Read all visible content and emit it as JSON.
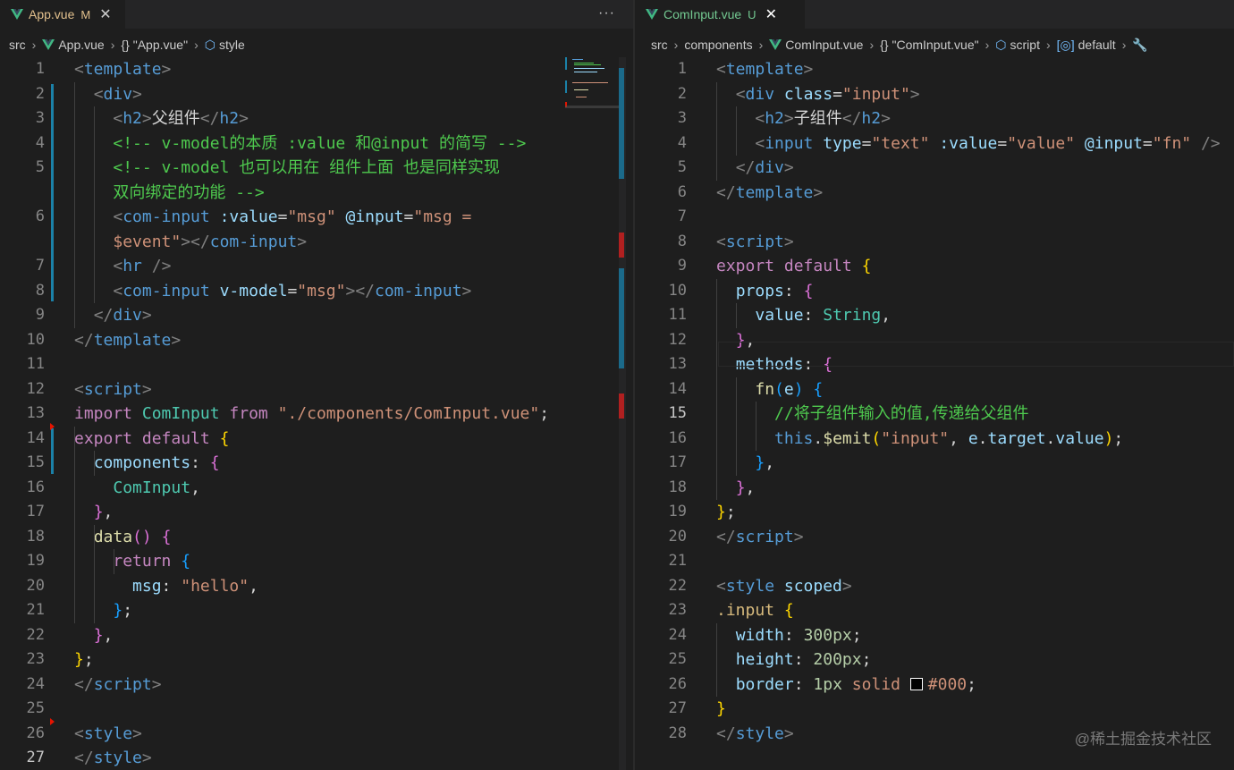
{
  "left": {
    "tab": {
      "name": "App.vue",
      "status": "M"
    },
    "more": "···",
    "breadcrumb": [
      "src",
      "App.vue",
      "\"App.vue\"",
      "style"
    ],
    "lines": [
      {
        "n": "1",
        "html": "<span class=\"t-tag\">&lt;</span><span class=\"t-tn\">template</span><span class=\"t-tag\">&gt;</span>"
      },
      {
        "n": "2",
        "html": "  <span class=\"t-tag\">&lt;</span><span class=\"t-tn\">div</span><span class=\"t-tag\">&gt;</span>"
      },
      {
        "n": "3",
        "html": "    <span class=\"t-tag\">&lt;</span><span class=\"t-tn\">h2</span><span class=\"t-tag\">&gt;</span><span class=\"t-txt\">父组件</span><span class=\"t-tag\">&lt;/</span><span class=\"t-tn\">h2</span><span class=\"t-tag\">&gt;</span>"
      },
      {
        "n": "4",
        "html": "    <span class=\"t-green\">&lt;!-- v-model的本质 :value 和@input 的简写 --&gt;</span>"
      },
      {
        "n": "5",
        "html": "    <span class=\"t-green\">&lt;!-- v-model 也可以用在 组件上面 也是同样实现</span>"
      },
      {
        "n": "",
        "html": "    <span class=\"t-green\">双向绑定的功能 --&gt;</span>"
      },
      {
        "n": "6",
        "html": "    <span class=\"t-tag\">&lt;</span><span class=\"t-tn\">com-input</span> <span class=\"t-attr\">:value</span><span class=\"t-punc\">=</span><span class=\"t-str\">\"msg\"</span> <span class=\"t-attr\">@input</span><span class=\"t-punc\">=</span><span class=\"t-str\">\"msg =</span>"
      },
      {
        "n": "",
        "html": "    <span class=\"t-str\">$event\"</span><span class=\"t-tag\">&gt;&lt;/</span><span class=\"t-tn\">com-input</span><span class=\"t-tag\">&gt;</span>"
      },
      {
        "n": "7",
        "html": "    <span class=\"t-tag\">&lt;</span><span class=\"t-tn\">hr</span> <span class=\"t-tag\">/&gt;</span>"
      },
      {
        "n": "8",
        "html": "    <span class=\"t-tag\">&lt;</span><span class=\"t-tn\">com-input</span> <span class=\"t-attr\">v-model</span><span class=\"t-punc\">=</span><span class=\"t-str\">\"msg\"</span><span class=\"t-tag\">&gt;&lt;/</span><span class=\"t-tn\">com-input</span><span class=\"t-tag\">&gt;</span>"
      },
      {
        "n": "9",
        "html": "  <span class=\"t-tag\">&lt;/</span><span class=\"t-tn\">div</span><span class=\"t-tag\">&gt;</span>"
      },
      {
        "n": "10",
        "html": "<span class=\"t-tag\">&lt;/</span><span class=\"t-tn\">template</span><span class=\"t-tag\">&gt;</span>"
      },
      {
        "n": "11",
        "html": ""
      },
      {
        "n": "12",
        "html": "<span class=\"t-tag\">&lt;</span><span class=\"t-tn\">script</span><span class=\"t-tag\">&gt;</span>"
      },
      {
        "n": "13",
        "html": "<span class=\"t-kw\">import</span> <span class=\"t-type\">ComInput</span> <span class=\"t-kw\">from</span> <span class=\"t-str\">\"./components/ComInput.vue\"</span><span class=\"t-punc\">;</span>"
      },
      {
        "n": "14",
        "html": "<span class=\"t-kw\">export</span> <span class=\"t-kw\">default</span> <span class=\"t-b1\">{</span>"
      },
      {
        "n": "15",
        "html": "  <span class=\"t-prop\">components</span><span class=\"t-punc\">:</span> <span class=\"t-b2\">{</span>"
      },
      {
        "n": "16",
        "html": "    <span class=\"t-type\">ComInput</span><span class=\"t-punc\">,</span>"
      },
      {
        "n": "17",
        "html": "  <span class=\"t-b2\">}</span><span class=\"t-punc\">,</span>"
      },
      {
        "n": "18",
        "html": "  <span class=\"t-fn\">data</span><span class=\"t-b2\">()</span> <span class=\"t-b2\">{</span>"
      },
      {
        "n": "19",
        "html": "    <span class=\"t-kw\">return</span> <span class=\"t-b3\">{</span>"
      },
      {
        "n": "20",
        "html": "      <span class=\"t-prop\">msg</span><span class=\"t-punc\">:</span> <span class=\"t-str\">\"hello\"</span><span class=\"t-punc\">,</span>"
      },
      {
        "n": "21",
        "html": "    <span class=\"t-b3\">}</span><span class=\"t-punc\">;</span>"
      },
      {
        "n": "22",
        "html": "  <span class=\"t-b2\">}</span><span class=\"t-punc\">,</span>"
      },
      {
        "n": "23",
        "html": "<span class=\"t-b1\">}</span><span class=\"t-punc\">;</span>"
      },
      {
        "n": "24",
        "html": "<span class=\"t-tag\">&lt;/</span><span class=\"t-tn\">script</span><span class=\"t-tag\">&gt;</span>"
      },
      {
        "n": "25",
        "html": ""
      },
      {
        "n": "26",
        "html": "<span class=\"t-tag\">&lt;</span><span class=\"t-tn\">style</span><span class=\"t-tag\">&gt;</span>"
      },
      {
        "n": "27",
        "html": "<span class=\"t-tag\">&lt;/</span><span class=\"t-tn\">style</span><span class=\"t-tag\">&gt;</span>"
      }
    ]
  },
  "right": {
    "tab": {
      "name": "ComInput.vue",
      "status": "U"
    },
    "breadcrumb": [
      "src",
      "components",
      "ComInput.vue",
      "\"ComInput.vue\"",
      "script",
      "default"
    ],
    "lines": [
      {
        "n": "1",
        "html": "<span class=\"t-tag\">&lt;</span><span class=\"t-tn\">template</span><span class=\"t-tag\">&gt;</span>"
      },
      {
        "n": "2",
        "html": "  <span class=\"t-tag\">&lt;</span><span class=\"t-tn\">div</span> <span class=\"t-attr\">class</span><span class=\"t-punc\">=</span><span class=\"t-str\">\"input\"</span><span class=\"t-tag\">&gt;</span>"
      },
      {
        "n": "3",
        "html": "    <span class=\"t-tag\">&lt;</span><span class=\"t-tn\">h2</span><span class=\"t-tag\">&gt;</span><span class=\"t-txt\">子组件</span><span class=\"t-tag\">&lt;/</span><span class=\"t-tn\">h2</span><span class=\"t-tag\">&gt;</span>"
      },
      {
        "n": "4",
        "html": "    <span class=\"t-tag\">&lt;</span><span class=\"t-tn\">input</span> <span class=\"t-attr\">type</span><span class=\"t-punc\">=</span><span class=\"t-str\">\"text\"</span> <span class=\"t-attr\">:value</span><span class=\"t-punc\">=</span><span class=\"t-str\">\"value\"</span> <span class=\"t-attr\">@input</span><span class=\"t-punc\">=</span><span class=\"t-str\">\"fn\"</span> <span class=\"t-tag\">/&gt;</span>"
      },
      {
        "n": "5",
        "html": "  <span class=\"t-tag\">&lt;/</span><span class=\"t-tn\">div</span><span class=\"t-tag\">&gt;</span>"
      },
      {
        "n": "6",
        "html": "<span class=\"t-tag\">&lt;/</span><span class=\"t-tn\">template</span><span class=\"t-tag\">&gt;</span>"
      },
      {
        "n": "7",
        "html": ""
      },
      {
        "n": "8",
        "html": "<span class=\"t-tag\">&lt;</span><span class=\"t-tn\">script</span><span class=\"t-tag\">&gt;</span>"
      },
      {
        "n": "9",
        "html": "<span class=\"t-kw\">export</span> <span class=\"t-kw\">default</span> <span class=\"t-b1\">{</span>"
      },
      {
        "n": "10",
        "html": "  <span class=\"t-prop\">props</span><span class=\"t-punc\">:</span> <span class=\"t-b2\">{</span>"
      },
      {
        "n": "11",
        "html": "    <span class=\"t-prop\">value</span><span class=\"t-punc\">:</span> <span class=\"t-type\">String</span><span class=\"t-punc\">,</span>"
      },
      {
        "n": "12",
        "html": "  <span class=\"t-b2\">}</span><span class=\"t-punc\">,</span>"
      },
      {
        "n": "13",
        "html": "  <span class=\"t-prop\">methods</span><span class=\"t-punc\">:</span> <span class=\"t-b2\">{</span>"
      },
      {
        "n": "14",
        "html": "    <span class=\"t-fn\">fn</span><span class=\"t-b3\">(</span><span class=\"t-prop\">e</span><span class=\"t-b3\">)</span> <span class=\"t-b3\">{</span>"
      },
      {
        "n": "15",
        "html": "      <span class=\"t-green\">//将子组件输入的值,传递给父组件</span>"
      },
      {
        "n": "16",
        "html": "      <span class=\"t-blue\">this</span><span class=\"t-punc\">.</span><span class=\"t-fn\">$emit</span><span class=\"t-b1\">(</span><span class=\"t-str\">\"input\"</span><span class=\"t-punc\">,</span> <span class=\"t-prop\">e</span><span class=\"t-punc\">.</span><span class=\"t-prop\">target</span><span class=\"t-punc\">.</span><span class=\"t-prop\">value</span><span class=\"t-b1\">)</span><span class=\"t-punc\">;</span>"
      },
      {
        "n": "17",
        "html": "    <span class=\"t-b3\">}</span><span class=\"t-punc\">,</span>"
      },
      {
        "n": "18",
        "html": "  <span class=\"t-b2\">}</span><span class=\"t-punc\">,</span>"
      },
      {
        "n": "19",
        "html": "<span class=\"t-b1\">}</span><span class=\"t-punc\">;</span>"
      },
      {
        "n": "20",
        "html": "<span class=\"t-tag\">&lt;/</span><span class=\"t-tn\">script</span><span class=\"t-tag\">&gt;</span>"
      },
      {
        "n": "21",
        "html": ""
      },
      {
        "n": "22",
        "html": "<span class=\"t-tag\">&lt;</span><span class=\"t-tn\">style</span> <span class=\"t-attr\">scoped</span><span class=\"t-tag\">&gt;</span>"
      },
      {
        "n": "23",
        "html": "<span class=\"t-sel\">.input</span> <span class=\"t-b1\">{</span>"
      },
      {
        "n": "24",
        "html": "  <span class=\"t-prop\">width</span><span class=\"t-punc\">:</span> <span class=\"t-num\">300px</span><span class=\"t-punc\">;</span>"
      },
      {
        "n": "25",
        "html": "  <span class=\"t-prop\">height</span><span class=\"t-punc\">:</span> <span class=\"t-num\">200px</span><span class=\"t-punc\">;</span>"
      },
      {
        "n": "26",
        "html": "  <span class=\"t-prop\">border</span><span class=\"t-punc\">:</span> <span class=\"t-num\">1px</span> <span class=\"t-str\">solid</span> <span class=\"swatch\"></span><span class=\"t-str\">#000</span><span class=\"t-punc\">;</span>"
      },
      {
        "n": "27",
        "html": "<span class=\"t-b1\">}</span>"
      },
      {
        "n": "28",
        "html": "<span class=\"t-tag\">&lt;/</span><span class=\"t-tn\">style</span><span class=\"t-tag\">&gt;</span>"
      }
    ]
  },
  "watermark": "@稀土掘金技术社区",
  "colors": {
    "background": "#1e1e1e",
    "tab_modified": "#e2c08d",
    "line_number": "#858585",
    "git_modified": "#1b81a8",
    "git_deleted": "#e51400"
  }
}
